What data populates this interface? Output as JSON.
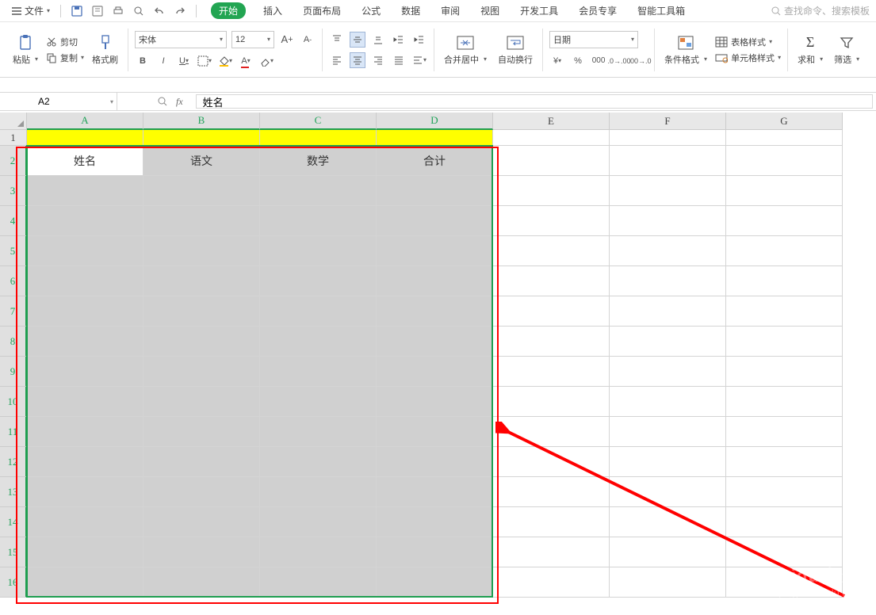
{
  "menu": {
    "file": "文件",
    "tabs": [
      "开始",
      "插入",
      "页面布局",
      "公式",
      "数据",
      "审阅",
      "视图",
      "开发工具",
      "会员专享",
      "智能工具箱"
    ],
    "search_placeholder": "查找命令、搜索模板"
  },
  "ribbon": {
    "paste": "粘贴",
    "cut": "剪切",
    "copy": "复制",
    "format_painter": "格式刷",
    "font_name": "宋体",
    "font_size": "12",
    "merge_center": "合并居中",
    "auto_wrap": "自动换行",
    "number_format": "日期",
    "cond_format": "条件格式",
    "table_style": "表格样式",
    "cell_style": "单元格样式",
    "sum": "求和",
    "filter": "筛选"
  },
  "name_box": "A2",
  "formula": "姓名",
  "columns": [
    "A",
    "B",
    "C",
    "D",
    "E",
    "F",
    "G"
  ],
  "rows": [
    "1",
    "2",
    "3",
    "4",
    "5",
    "6",
    "7",
    "8",
    "9",
    "10",
    "11",
    "12",
    "13",
    "14",
    "15",
    "16"
  ],
  "cells": {
    "r2": [
      "姓名",
      "语文",
      "数学",
      "合计"
    ]
  },
  "watermark": {
    "top": "Baidu 经验",
    "url": "jingyan.baidu.com"
  }
}
